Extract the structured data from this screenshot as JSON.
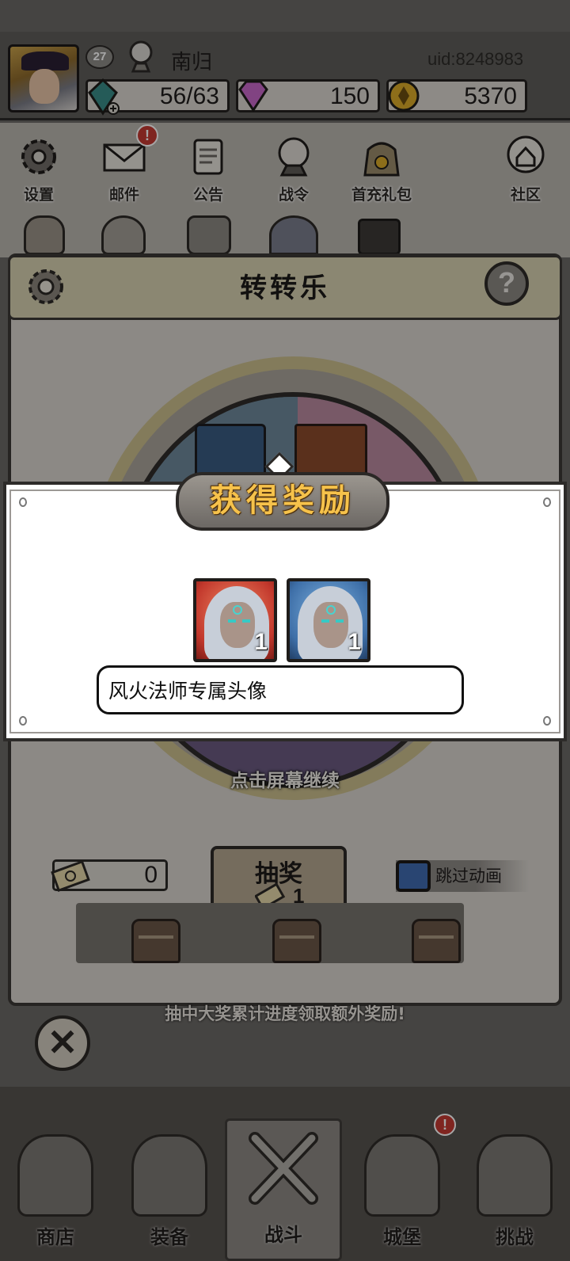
{
  "header": {
    "level": "27",
    "player_name": "南归",
    "uid": "uid:8248983",
    "energy": "56/63",
    "gems": "150",
    "gold": "5370"
  },
  "menu": {
    "items": [
      {
        "label": "设置",
        "icon": "gear-icon"
      },
      {
        "label": "邮件",
        "icon": "mail-icon",
        "badge": "!"
      },
      {
        "label": "公告",
        "icon": "scroll-icon"
      },
      {
        "label": "战令",
        "icon": "crystal-ball-icon"
      },
      {
        "label": "首充礼包",
        "icon": "gift-bag-icon"
      },
      {
        "label": "社区",
        "icon": "home-bubble-icon"
      }
    ]
  },
  "panel": {
    "title": "转转乐",
    "help": "?",
    "tap_continue": "点击屏幕继续",
    "ticket_count": "0",
    "draw_label": "抽奖",
    "draw_cost": "1",
    "skip_label": "跳过动画",
    "progress_hint": "抽中大奖累计进度领取额外奖励!"
  },
  "reward_dialog": {
    "title": "获得奖励",
    "items": [
      {
        "qty": "1",
        "frame_color": "#c2382c"
      },
      {
        "qty": "1",
        "frame_color": "#3e6fa8"
      }
    ],
    "description": "风火法师专属头像"
  },
  "close": "✕",
  "bottom_nav": {
    "tabs": [
      {
        "label": "商店",
        "icon": "shop-hut-icon"
      },
      {
        "label": "装备",
        "icon": "backpack-icon"
      },
      {
        "label": "战斗",
        "icon": "crossed-swords-icon",
        "active": true
      },
      {
        "label": "城堡",
        "icon": "castle-icon",
        "badge": "!"
      },
      {
        "label": "挑战",
        "icon": "shield-emblem-icon"
      }
    ]
  },
  "colors": {
    "accent_gold": "#f6c24b",
    "badge_red": "#c43a32",
    "checkbox_blue": "#3f6bb0"
  }
}
